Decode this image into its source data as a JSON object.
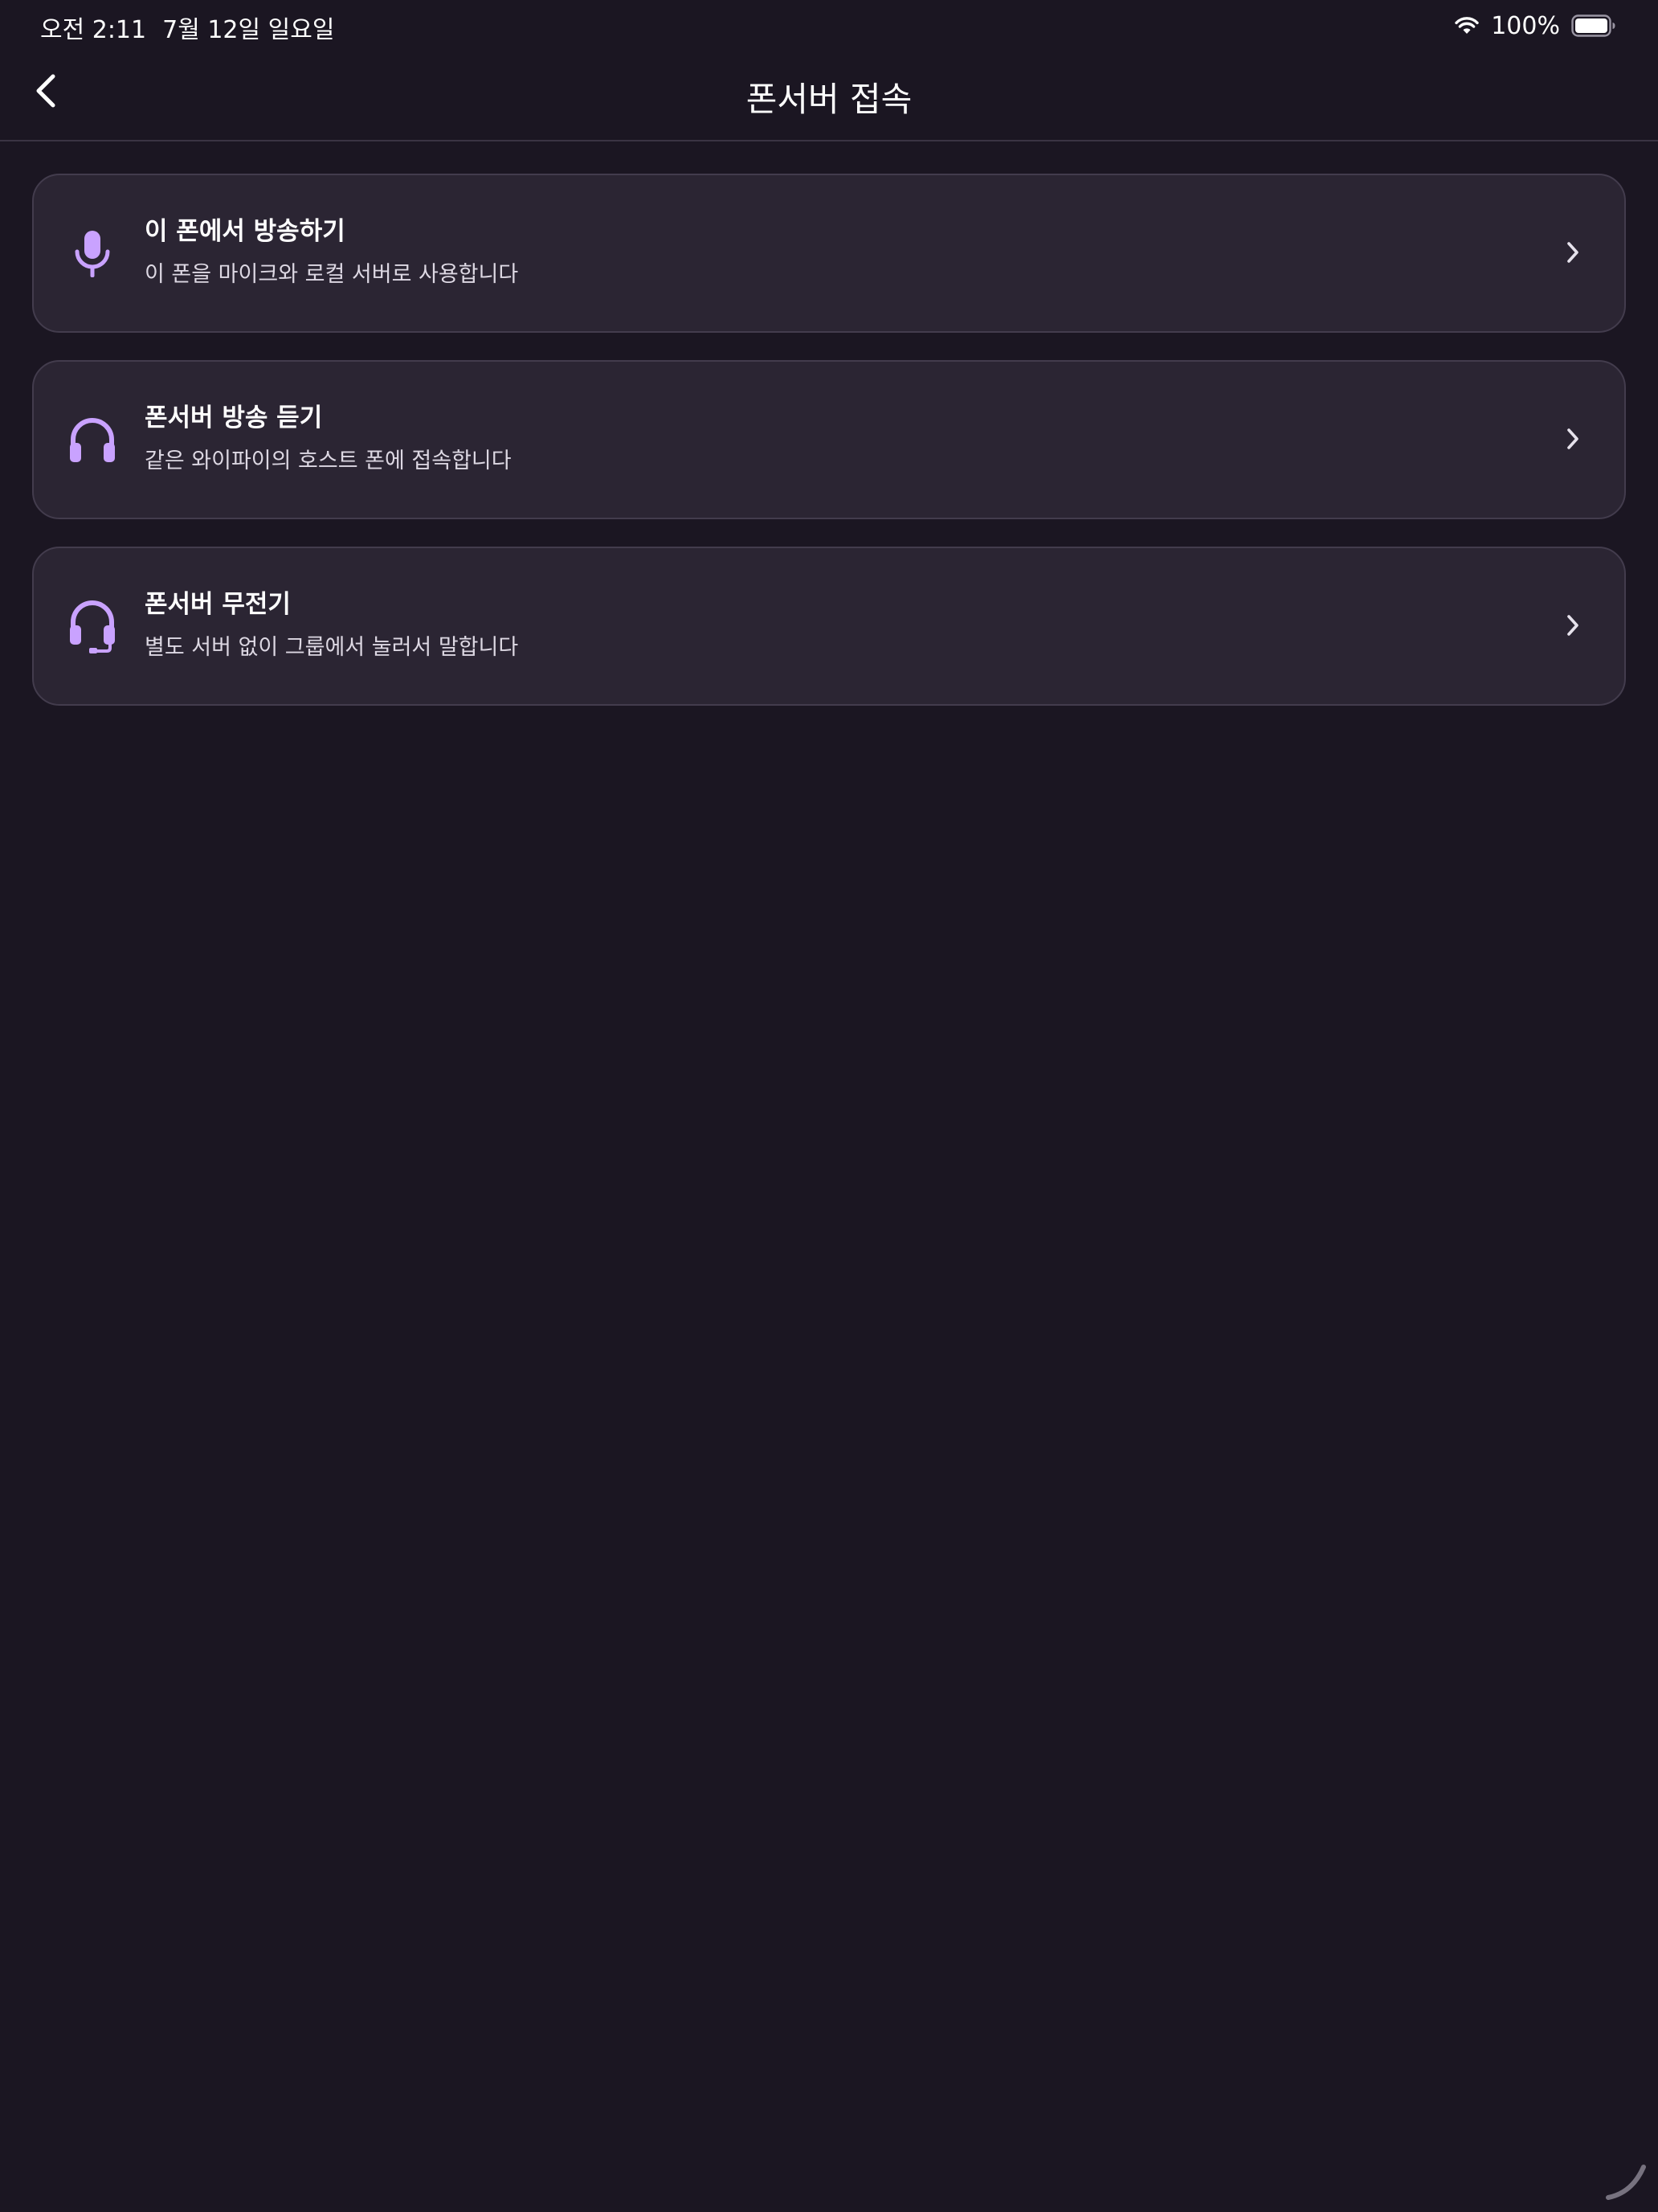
{
  "status_bar": {
    "time": "오전 2:11",
    "date": "7월 12일 일요일",
    "battery": "100%",
    "wifi_icon": "wifi-icon",
    "battery_icon": "battery-icon"
  },
  "nav": {
    "title": "폰서버 접속",
    "back_icon": "chevron-left-icon"
  },
  "cards": [
    {
      "icon": "microphone-icon",
      "title": "이 폰에서 방송하기",
      "subtitle": "이 폰을 마이크와 로컬 서버로 사용합니다"
    },
    {
      "icon": "headphones-icon",
      "title": "폰서버 방송 듣기",
      "subtitle": "같은 와이파이의 호스트 폰에 접속합니다"
    },
    {
      "icon": "headset-mic-icon",
      "title": "폰서버 무전기",
      "subtitle": "별도 서버 없이 그룹에서 눌러서 말합니다"
    }
  ],
  "colors": {
    "background": "#1b1622",
    "card_background": "#2b2533",
    "card_border": "#433c4d",
    "accent": "#c9a2ff",
    "text_primary": "#ffffff",
    "text_secondary": "#ddd8e3"
  }
}
